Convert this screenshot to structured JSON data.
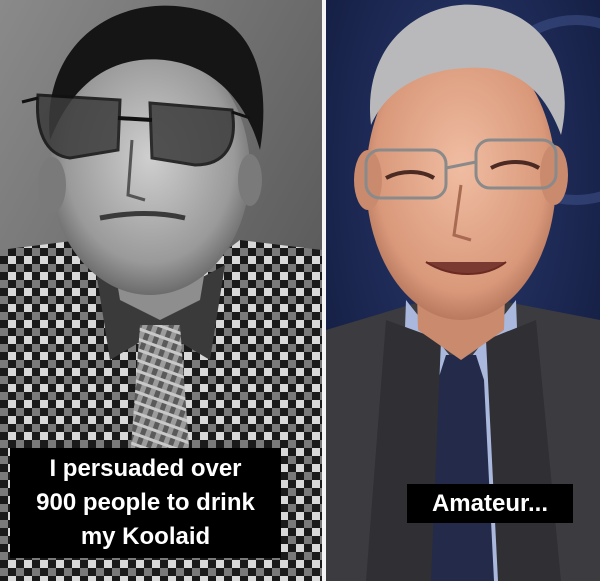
{
  "left_panel": {
    "caption": "I persuaded over\n900 people to drink\nmy Koolaid"
  },
  "right_panel": {
    "caption": "Amateur..."
  },
  "colors": {
    "caption_background": "#000000",
    "caption_text": "#ffffff",
    "divider": "#f4f4f4",
    "right_background": "#141f45"
  }
}
